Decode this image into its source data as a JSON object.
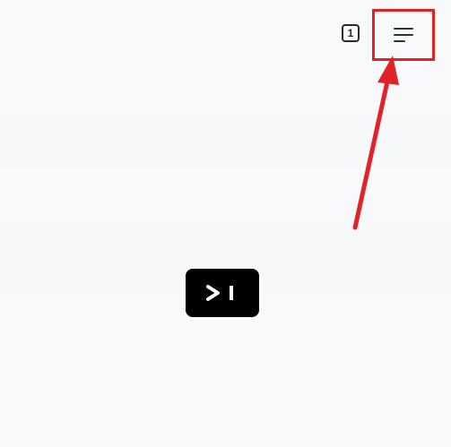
{
  "toolbar": {
    "tab_count": "1",
    "menu_icon": "hamburger-menu-icon"
  },
  "annotation": {
    "highlight_color": "#e32228",
    "arrow_color": "#e32228"
  },
  "launcher": {
    "icon": "terminal-prompt-icon",
    "tile_color": "#000000"
  }
}
